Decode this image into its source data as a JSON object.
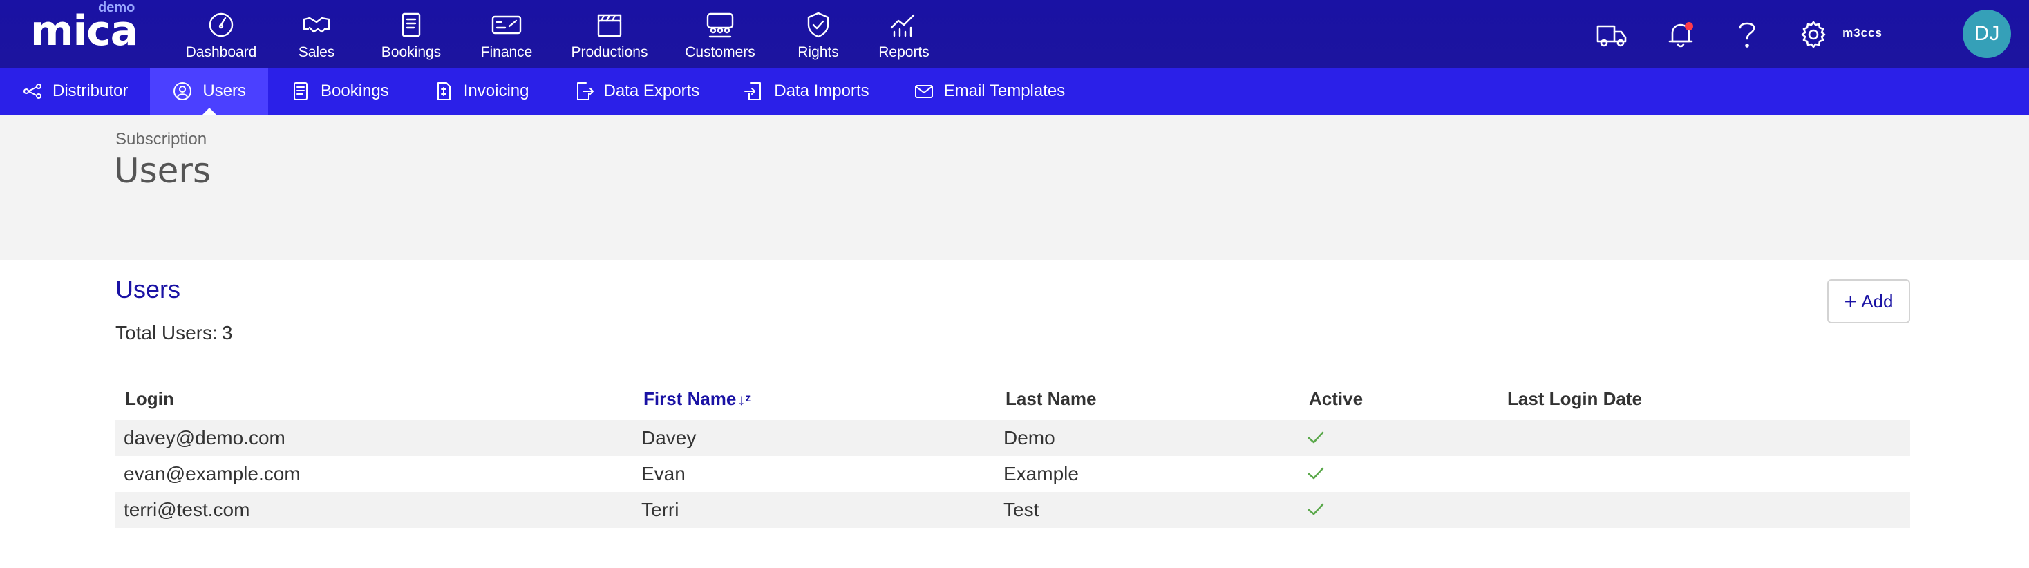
{
  "app": {
    "logo_text": "mica",
    "env_badge": "demo",
    "tenant": "m3ccs",
    "avatar_initials": "DJ"
  },
  "main_nav": [
    {
      "label": "Dashboard",
      "icon": "dashboard-gauge-icon"
    },
    {
      "label": "Sales",
      "icon": "handshake-icon"
    },
    {
      "label": "Bookings",
      "icon": "book-icon"
    },
    {
      "label": "Finance",
      "icon": "cheque-icon"
    },
    {
      "label": "Productions",
      "icon": "clapperboard-icon"
    },
    {
      "label": "Customers",
      "icon": "people-icon"
    },
    {
      "label": "Rights",
      "icon": "shield-check-icon"
    },
    {
      "label": "Reports",
      "icon": "chart-icon"
    }
  ],
  "top_icons": [
    {
      "icon": "truck-icon"
    },
    {
      "icon": "bell-icon"
    },
    {
      "icon": "help-icon"
    },
    {
      "icon": "gear-icon"
    }
  ],
  "sub_nav": [
    {
      "label": "Distributor",
      "icon": "network-icon",
      "active": false
    },
    {
      "label": "Users",
      "icon": "user-circle-icon",
      "active": true
    },
    {
      "label": "Bookings",
      "icon": "book-icon",
      "active": false
    },
    {
      "label": "Invoicing",
      "icon": "invoice-icon",
      "active": false
    },
    {
      "label": "Data Exports",
      "icon": "export-icon",
      "active": false
    },
    {
      "label": "Data Imports",
      "icon": "import-icon",
      "active": false
    },
    {
      "label": "Email Templates",
      "icon": "envelope-icon",
      "active": false
    }
  ],
  "page": {
    "breadcrumb": "Subscription",
    "title": "Users"
  },
  "section": {
    "title": "Users",
    "total_label": "Total Users:",
    "total_value": "3",
    "add_label": "Add"
  },
  "table": {
    "columns": [
      "Login",
      "First Name",
      "Last Name",
      "Active",
      "Last Login Date"
    ],
    "sorted_column": "First Name",
    "sort_icon": "sort-alpha-icon",
    "rows": [
      {
        "login": "davey@demo.com",
        "first_name": "Davey",
        "last_name": "Demo",
        "active": true,
        "last_login": ""
      },
      {
        "login": "evan@example.com",
        "first_name": "Evan",
        "last_name": "Example",
        "active": true,
        "last_login": ""
      },
      {
        "login": "terri@test.com",
        "first_name": "Terri",
        "last_name": "Test",
        "active": true,
        "last_login": ""
      }
    ]
  },
  "colors": {
    "topbar": "#1a12a4",
    "subnav": "#2b20e8",
    "subnav_active": "#4b40ff",
    "accent": "#1a12a4",
    "check": "#5aa84a",
    "notification": "#ff3b4a"
  }
}
